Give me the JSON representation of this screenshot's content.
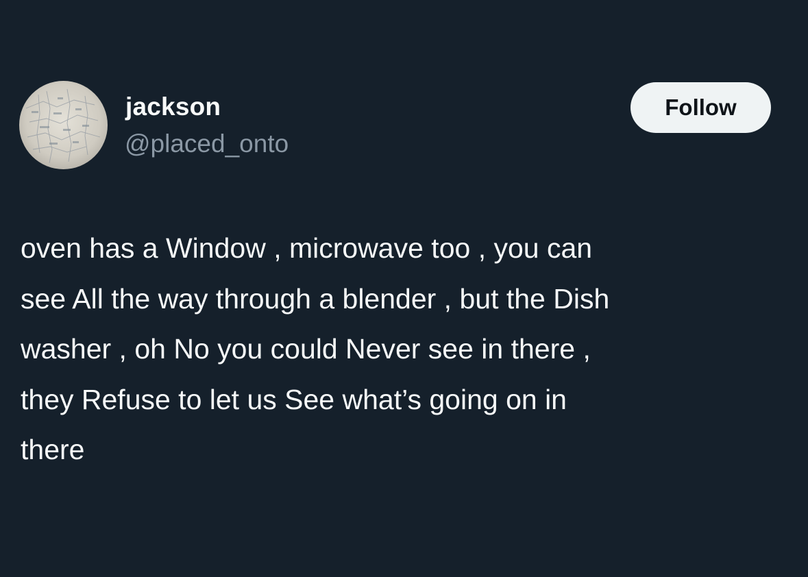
{
  "author": {
    "display_name": "jackson",
    "handle": "@placed_onto",
    "avatar_icon": "paper-map-avatar"
  },
  "actions": {
    "follow_label": "Follow"
  },
  "post": {
    "lines": [
      "oven has a Window , microwave too , you can",
      "see All the way through a blender , but the Dish",
      "washer , oh No you could Never see in there ,",
      "they Refuse to let us See what’s going on in",
      "there"
    ]
  },
  "colors": {
    "background": "#15202b",
    "text_primary": "#f7f9f9",
    "text_secondary": "#8b98a5",
    "button_background": "#eff3f4",
    "button_text": "#0f1419"
  }
}
